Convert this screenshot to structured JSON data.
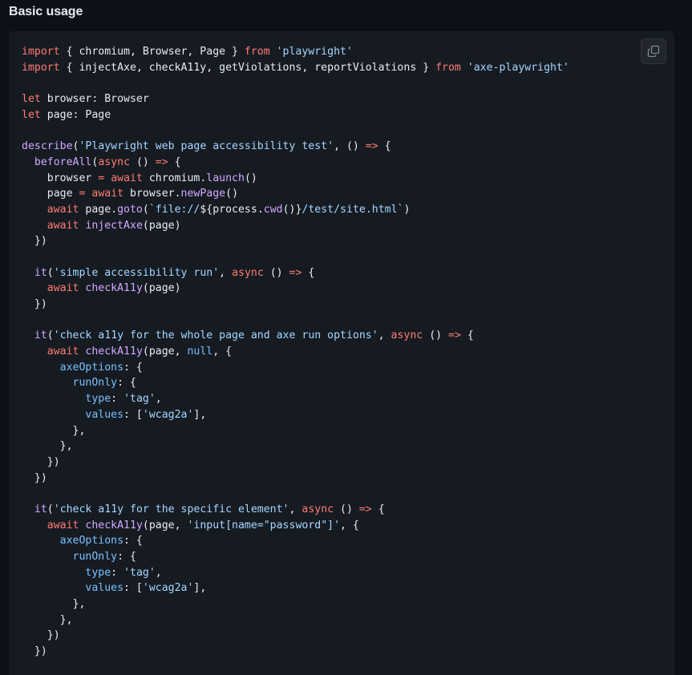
{
  "heading": "Basic usage",
  "copy_button": {
    "icon": "copy-icon"
  },
  "colors": {
    "keyword": "#ff7b72",
    "string": "#a5d6ff",
    "function": "#d2a8ff",
    "constant": "#79c0ff",
    "plain": "#e6edf3",
    "background": "#161b22"
  },
  "code_lines": [
    [
      [
        "kw",
        "import"
      ],
      [
        "pl",
        " { chromium, Browser, Page } "
      ],
      [
        "kw",
        "from"
      ],
      [
        "pl",
        " "
      ],
      [
        "str",
        "'playwright'"
      ]
    ],
    [
      [
        "kw",
        "import"
      ],
      [
        "pl",
        " { injectAxe, checkA11y, getViolations, reportViolations } "
      ],
      [
        "kw",
        "from"
      ],
      [
        "pl",
        " "
      ],
      [
        "str",
        "'axe-playwright'"
      ]
    ],
    [],
    [
      [
        "kw",
        "let"
      ],
      [
        "pl",
        " browser: Browser"
      ]
    ],
    [
      [
        "kw",
        "let"
      ],
      [
        "pl",
        " page: Page"
      ]
    ],
    [],
    [
      [
        "fn",
        "describe"
      ],
      [
        "pl",
        "("
      ],
      [
        "str",
        "'Playwright web page accessibility test'"
      ],
      [
        "pl",
        ", () "
      ],
      [
        "kw",
        "=>"
      ],
      [
        "pl",
        " {"
      ]
    ],
    [
      [
        "pl",
        "  "
      ],
      [
        "fn",
        "beforeAll"
      ],
      [
        "pl",
        "("
      ],
      [
        "kw",
        "async"
      ],
      [
        "pl",
        " () "
      ],
      [
        "kw",
        "=>"
      ],
      [
        "pl",
        " {"
      ]
    ],
    [
      [
        "pl",
        "    browser "
      ],
      [
        "kw",
        "="
      ],
      [
        "pl",
        " "
      ],
      [
        "kw",
        "await"
      ],
      [
        "pl",
        " chromium."
      ],
      [
        "fn",
        "launch"
      ],
      [
        "pl",
        "()"
      ]
    ],
    [
      [
        "pl",
        "    page "
      ],
      [
        "kw",
        "="
      ],
      [
        "pl",
        " "
      ],
      [
        "kw",
        "await"
      ],
      [
        "pl",
        " browser."
      ],
      [
        "fn",
        "newPage"
      ],
      [
        "pl",
        "()"
      ]
    ],
    [
      [
        "pl",
        "    "
      ],
      [
        "kw",
        "await"
      ],
      [
        "pl",
        " page."
      ],
      [
        "fn",
        "goto"
      ],
      [
        "pl",
        "("
      ],
      [
        "str",
        "`file://"
      ],
      [
        "pl",
        "${process."
      ],
      [
        "fn",
        "cwd"
      ],
      [
        "pl",
        "()}"
      ],
      [
        "str",
        "/test/site.html`"
      ],
      [
        "pl",
        ")"
      ]
    ],
    [
      [
        "pl",
        "    "
      ],
      [
        "kw",
        "await"
      ],
      [
        "pl",
        " "
      ],
      [
        "fn",
        "injectAxe"
      ],
      [
        "pl",
        "(page)"
      ]
    ],
    [
      [
        "pl",
        "  })"
      ]
    ],
    [],
    [
      [
        "pl",
        "  "
      ],
      [
        "fn",
        "it"
      ],
      [
        "pl",
        "("
      ],
      [
        "str",
        "'simple accessibility run'"
      ],
      [
        "pl",
        ", "
      ],
      [
        "kw",
        "async"
      ],
      [
        "pl",
        " () "
      ],
      [
        "kw",
        "=>"
      ],
      [
        "pl",
        " {"
      ]
    ],
    [
      [
        "pl",
        "    "
      ],
      [
        "kw",
        "await"
      ],
      [
        "pl",
        " "
      ],
      [
        "fn",
        "checkA11y"
      ],
      [
        "pl",
        "(page)"
      ]
    ],
    [
      [
        "pl",
        "  })"
      ]
    ],
    [],
    [
      [
        "pl",
        "  "
      ],
      [
        "fn",
        "it"
      ],
      [
        "pl",
        "("
      ],
      [
        "str",
        "'check a11y for the whole page and axe run options'"
      ],
      [
        "pl",
        ", "
      ],
      [
        "kw",
        "async"
      ],
      [
        "pl",
        " () "
      ],
      [
        "kw",
        "=>"
      ],
      [
        "pl",
        " {"
      ]
    ],
    [
      [
        "pl",
        "    "
      ],
      [
        "kw",
        "await"
      ],
      [
        "pl",
        " "
      ],
      [
        "fn",
        "checkA11y"
      ],
      [
        "pl",
        "(page, "
      ],
      [
        "cst",
        "null"
      ],
      [
        "pl",
        ", {"
      ]
    ],
    [
      [
        "pl",
        "      "
      ],
      [
        "cst",
        "axeOptions"
      ],
      [
        "pl",
        ": {"
      ]
    ],
    [
      [
        "pl",
        "        "
      ],
      [
        "cst",
        "runOnly"
      ],
      [
        "pl",
        ": {"
      ]
    ],
    [
      [
        "pl",
        "          "
      ],
      [
        "cst",
        "type"
      ],
      [
        "pl",
        ": "
      ],
      [
        "str",
        "'tag'"
      ],
      [
        "pl",
        ","
      ]
    ],
    [
      [
        "pl",
        "          "
      ],
      [
        "cst",
        "values"
      ],
      [
        "pl",
        ": ["
      ],
      [
        "str",
        "'wcag2a'"
      ],
      [
        "pl",
        "],"
      ]
    ],
    [
      [
        "pl",
        "        },"
      ]
    ],
    [
      [
        "pl",
        "      },"
      ]
    ],
    [
      [
        "pl",
        "    })"
      ]
    ],
    [
      [
        "pl",
        "  })"
      ]
    ],
    [],
    [
      [
        "pl",
        "  "
      ],
      [
        "fn",
        "it"
      ],
      [
        "pl",
        "("
      ],
      [
        "str",
        "'check a11y for the specific element'"
      ],
      [
        "pl",
        ", "
      ],
      [
        "kw",
        "async"
      ],
      [
        "pl",
        " () "
      ],
      [
        "kw",
        "=>"
      ],
      [
        "pl",
        " {"
      ]
    ],
    [
      [
        "pl",
        "    "
      ],
      [
        "kw",
        "await"
      ],
      [
        "pl",
        " "
      ],
      [
        "fn",
        "checkA11y"
      ],
      [
        "pl",
        "(page, "
      ],
      [
        "str",
        "'input[name=\"password\"]'"
      ],
      [
        "pl",
        ", {"
      ]
    ],
    [
      [
        "pl",
        "      "
      ],
      [
        "cst",
        "axeOptions"
      ],
      [
        "pl",
        ": {"
      ]
    ],
    [
      [
        "pl",
        "        "
      ],
      [
        "cst",
        "runOnly"
      ],
      [
        "pl",
        ": {"
      ]
    ],
    [
      [
        "pl",
        "          "
      ],
      [
        "cst",
        "type"
      ],
      [
        "pl",
        ": "
      ],
      [
        "str",
        "'tag'"
      ],
      [
        "pl",
        ","
      ]
    ],
    [
      [
        "pl",
        "          "
      ],
      [
        "cst",
        "values"
      ],
      [
        "pl",
        ": ["
      ],
      [
        "str",
        "'wcag2a'"
      ],
      [
        "pl",
        "],"
      ]
    ],
    [
      [
        "pl",
        "        },"
      ]
    ],
    [
      [
        "pl",
        "      },"
      ]
    ],
    [
      [
        "pl",
        "    })"
      ]
    ],
    [
      [
        "pl",
        "  })"
      ]
    ]
  ]
}
